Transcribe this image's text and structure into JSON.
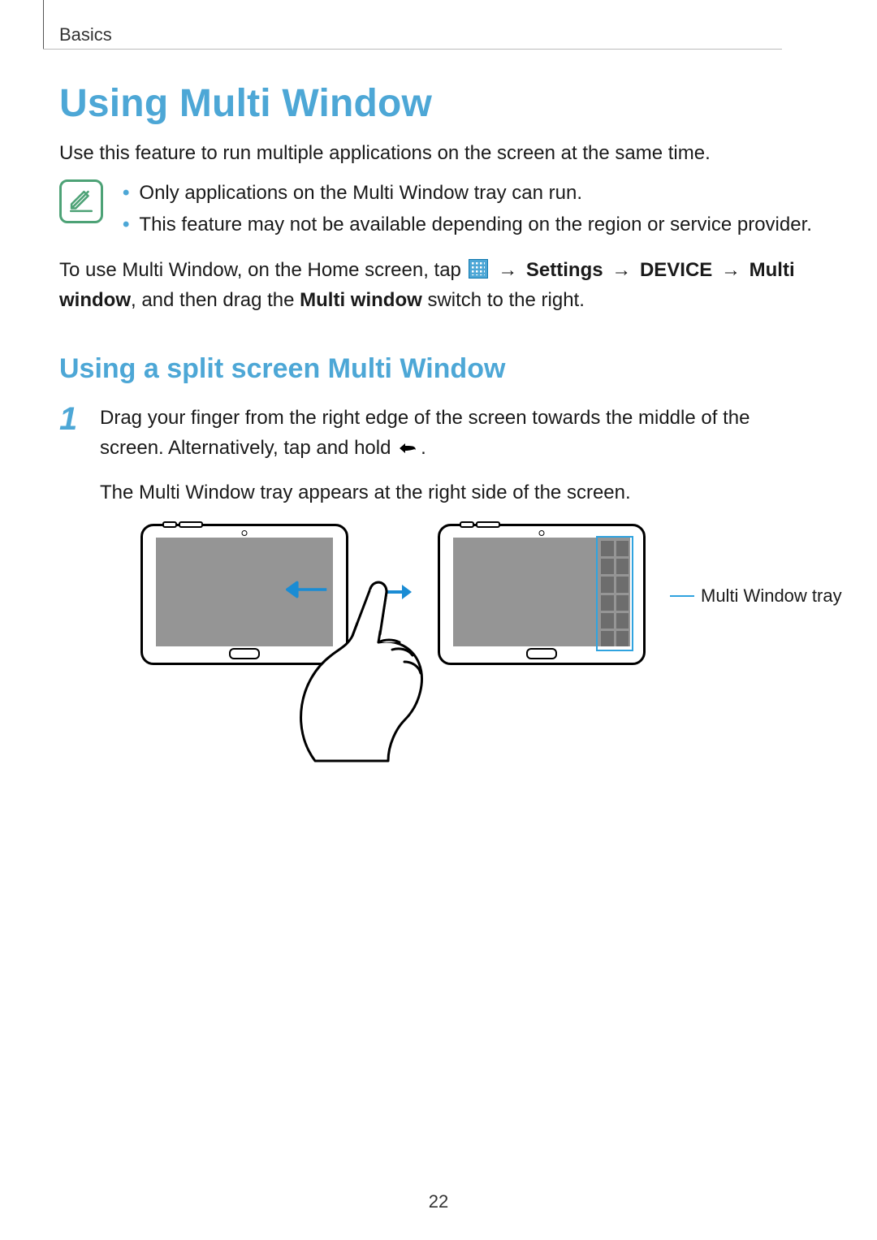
{
  "section_label": "Basics",
  "title": "Using Multi Window",
  "intro": "Use this feature to run multiple applications on the screen at the same time.",
  "note": {
    "items": [
      "Only applications on the Multi Window tray can run.",
      "This feature may not be available depending on the region or service provider."
    ]
  },
  "usage_sentence": {
    "prefix": "To use Multi Window, on the Home screen, tap ",
    "arrow": "→",
    "settings": "Settings",
    "device": "DEVICE",
    "multiwindow": "Multi window",
    "suffix1": ", and then drag the ",
    "bold_switch": "Multi window",
    "suffix2": " switch to the right."
  },
  "subhead": "Using a split screen Multi Window",
  "step1": {
    "number": "1",
    "line1_prefix": "Drag your finger from the right edge of the screen towards the middle of the screen. Alternatively, tap and hold ",
    "line1_suffix": ".",
    "line2": "The Multi Window tray appears at the right side of the screen."
  },
  "illustration": {
    "callout": "Multi Window tray"
  },
  "page_number": "22"
}
